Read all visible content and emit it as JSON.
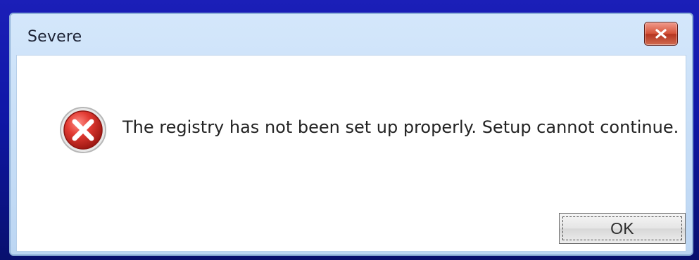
{
  "dialog": {
    "title": "Severe",
    "message": "The registry has not been set up properly.  Setup cannot continue.",
    "ok_label": "OK"
  },
  "icons": {
    "close": "close-icon",
    "error": "error-icon"
  },
  "colors": {
    "desktop_background": "#1b1fb8",
    "close_button": "#d45238",
    "error_icon": "#d72a25"
  }
}
